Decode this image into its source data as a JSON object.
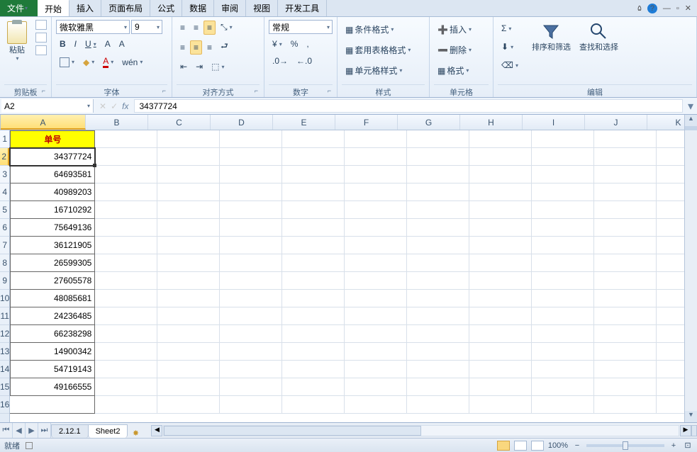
{
  "tabs": {
    "file": "文件",
    "home": "开始",
    "insert": "插入",
    "layout": "页面布局",
    "formulas": "公式",
    "data": "数据",
    "review": "审阅",
    "view": "视图",
    "dev": "开发工具"
  },
  "ribbon": {
    "clipboard": {
      "label": "剪贴板",
      "paste": "粘贴"
    },
    "font": {
      "label": "字体",
      "name": "微软雅黑",
      "size": "9",
      "bold": "B",
      "italic": "I",
      "underline": "U"
    },
    "align": {
      "label": "对齐方式"
    },
    "number": {
      "label": "数字",
      "format": "常规"
    },
    "style": {
      "label": "样式",
      "cond": "条件格式",
      "table": "套用表格格式",
      "cell": "单元格样式"
    },
    "cells": {
      "label": "单元格",
      "insert": "插入",
      "delete": "删除",
      "format": "格式"
    },
    "edit": {
      "label": "编辑",
      "sort": "排序和筛选",
      "find": "查找和选择"
    }
  },
  "namebox": "A2",
  "formula": "34377724",
  "columns": [
    "A",
    "B",
    "C",
    "D",
    "E",
    "F",
    "G",
    "H",
    "I",
    "J",
    "K"
  ],
  "header_cell": "单号",
  "rows": [
    "34377724",
    "64693581",
    "40989203",
    "16710292",
    "75649136",
    "36121905",
    "26599305",
    "27605578",
    "48085681",
    "24236485",
    "66238298",
    "14900342",
    "54719143",
    "49166555"
  ],
  "sheets": {
    "s1": "2.12.1",
    "s2": "Sheet2"
  },
  "status": {
    "ready": "就绪",
    "zoom": "100%"
  },
  "chart_data": {
    "type": "table",
    "columns": [
      "单号"
    ],
    "values": [
      34377724,
      64693581,
      40989203,
      16710292,
      75649136,
      36121905,
      26599305,
      27605578,
      48085681,
      24236485,
      66238298,
      14900342,
      54719143,
      49166555
    ]
  }
}
